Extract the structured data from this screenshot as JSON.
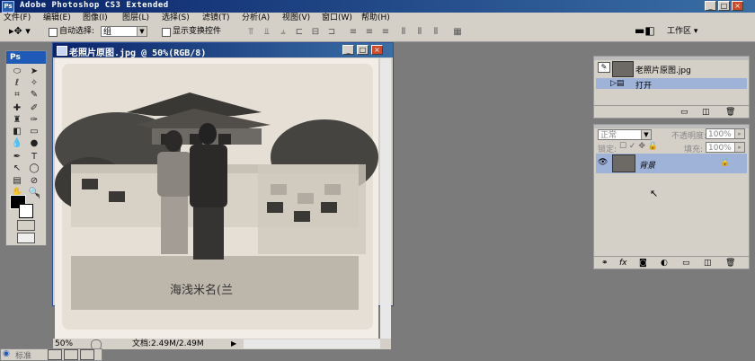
{
  "app": {
    "title": "Adobe Photoshop CS3 Extended",
    "logo": "Ps"
  },
  "window_controls": [
    "_",
    "□",
    "×"
  ],
  "menu": [
    "文件(F)",
    "编辑(E)",
    "图像(I)",
    "图层(L)",
    "选择(S)",
    "滤镜(T)",
    "分析(A)",
    "视图(V)",
    "窗口(W)",
    "帮助(H)"
  ],
  "options": {
    "auto_select_label": "自动选择:",
    "auto_select_value": "组",
    "show_transform_label": "显示变换控件",
    "workspace_label": "工作区"
  },
  "toolbox": {
    "header": "Ps"
  },
  "document": {
    "title": "老照片原图.jpg @ 50%(RGB/8)",
    "zoom": "50%",
    "doc_info": "文档:2.49M/2.49M",
    "photo_caption": "海浅米名(兰"
  },
  "history_panel": {
    "snapshot_name": "老照片原图.jpg",
    "open_step": "打开"
  },
  "layers_panel": {
    "blend_mode": "正常",
    "opacity_label": "不透明度:",
    "opacity_value": "100%",
    "lock_label": "锁定:",
    "fill_label": "填充:",
    "fill_value": "100%",
    "layer_name": "背景"
  },
  "taskbar": {
    "label": "标准"
  },
  "colors": {
    "app_bg": "#7b7b7b",
    "titlebar": "#0a246a",
    "chrome": "#d4d0c8",
    "selection": "#9fb3d8",
    "close_red": "#d04a2a"
  }
}
